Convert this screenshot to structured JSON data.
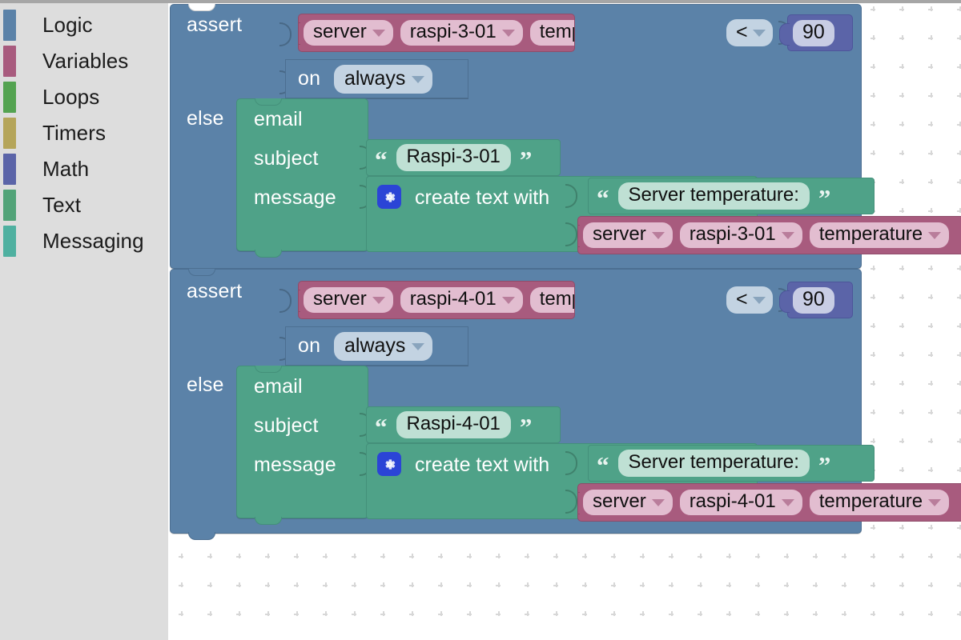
{
  "app": {
    "kind": "blockly-visual-programming-editor"
  },
  "toolbox": {
    "items": [
      {
        "label": "Logic",
        "color": "#5b82a8",
        "icon": "category-swatch"
      },
      {
        "label": "Variables",
        "color": "#a85b7e",
        "icon": "category-swatch"
      },
      {
        "label": "Loops",
        "color": "#54a351",
        "icon": "category-swatch"
      },
      {
        "label": "Timers",
        "color": "#b5a55a",
        "icon": "category-swatch"
      },
      {
        "label": "Math",
        "color": "#5b64a8",
        "icon": "category-swatch"
      },
      {
        "label": "Text",
        "color": "#52a378",
        "icon": "category-swatch"
      },
      {
        "label": "Messaging",
        "color": "#4fb0a0",
        "icon": "category-swatch"
      }
    ]
  },
  "workspace": {
    "grid": "dot-cross",
    "blocks": [
      {
        "type": "assert",
        "keyword_assert": "assert",
        "keyword_else": "else",
        "keyword_on": "on",
        "trigger": "always",
        "condition": {
          "variable": {
            "scope": "server",
            "device": "raspi-3-01",
            "property": "temperature"
          },
          "operator": "<",
          "value": "90"
        },
        "body": {
          "type": "email",
          "label": "email",
          "subject_label": "subject",
          "subject_value": "Raspi-3-01",
          "message_label": "message",
          "message": {
            "type": "create-text-with",
            "label": "create text with",
            "gear_icon": "gear-icon",
            "parts": [
              {
                "type": "text",
                "value": "Server temperature:"
              },
              {
                "type": "variable",
                "scope": "server",
                "device": "raspi-3-01",
                "property": "temperature"
              }
            ]
          }
        }
      },
      {
        "type": "assert",
        "keyword_assert": "assert",
        "keyword_else": "else",
        "keyword_on": "on",
        "trigger": "always",
        "condition": {
          "variable": {
            "scope": "server",
            "device": "raspi-4-01",
            "property": "temperature"
          },
          "operator": "<",
          "value": "90"
        },
        "body": {
          "type": "email",
          "label": "email",
          "subject_label": "subject",
          "subject_value": "Raspi-4-01",
          "message_label": "message",
          "message": {
            "type": "create-text-with",
            "label": "create text with",
            "gear_icon": "gear-icon",
            "parts": [
              {
                "type": "text",
                "value": "Server temperature:"
              },
              {
                "type": "variable",
                "scope": "server",
                "device": "raspi-4-01",
                "property": "temperature"
              }
            ]
          }
        }
      }
    ]
  },
  "colors": {
    "logic": "#5b82a8",
    "variables": "#a85b7e",
    "math": "#5b64a8",
    "text": "#4fa288",
    "messaging": "#4fa288",
    "toolbox_bg": "#dddddd",
    "workspace_bg": "#ffffff",
    "gear_badge": "#2b44d6"
  }
}
